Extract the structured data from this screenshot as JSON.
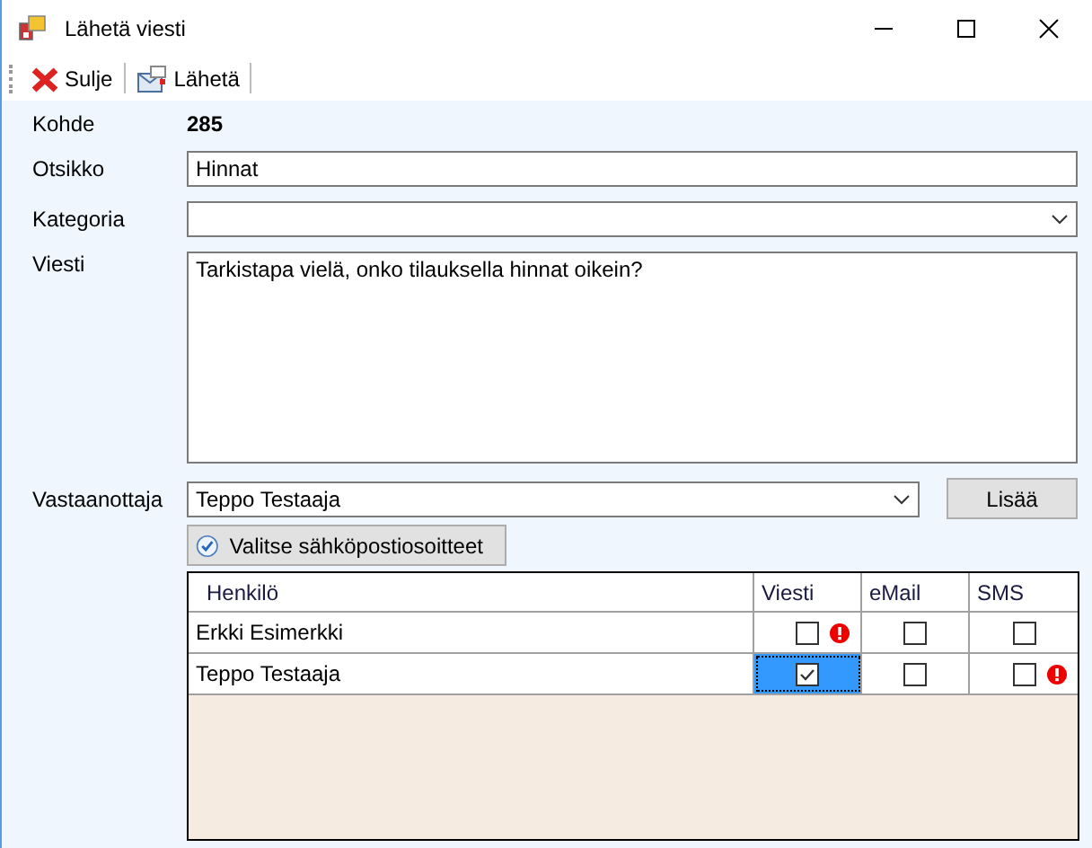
{
  "window": {
    "title": "Lähetä viesti"
  },
  "toolbar": [
    {
      "kind": "close",
      "label": "Sulje"
    },
    {
      "kind": "send",
      "label": "Lähetä"
    }
  ],
  "form": {
    "kohde_label": "Kohde",
    "kohde_value": "285",
    "otsikko_label": "Otsikko",
    "otsikko_value": "Hinnat",
    "kategoria_label": "Kategoria",
    "viesti_label": "Viesti",
    "viesti_value": "Tarkistapa vielä, onko tilauksella hinnat oikein?",
    "vastaanottaja_label": "Vastaanottaja",
    "vastaanottaja_value": "Teppo Testaaja",
    "add_button": "Lisää",
    "choose_button": "Valitse sähköpostiosoitteet"
  },
  "table": {
    "columns": [
      "Henkilö",
      "Viesti",
      "eMail",
      "SMS"
    ],
    "rows": [
      {
        "name": "Erkki Esimerkki",
        "cells": [
          {
            "checked": false,
            "warning": true,
            "selected": false
          },
          {
            "checked": false,
            "warning": false,
            "selected": false
          },
          {
            "checked": false,
            "warning": false,
            "selected": false
          }
        ]
      },
      {
        "name": "Teppo Testaaja",
        "cells": [
          {
            "checked": true,
            "warning": false,
            "selected": true
          },
          {
            "checked": false,
            "warning": false,
            "selected": false
          },
          {
            "checked": false,
            "warning": true,
            "selected": false
          }
        ]
      }
    ]
  }
}
